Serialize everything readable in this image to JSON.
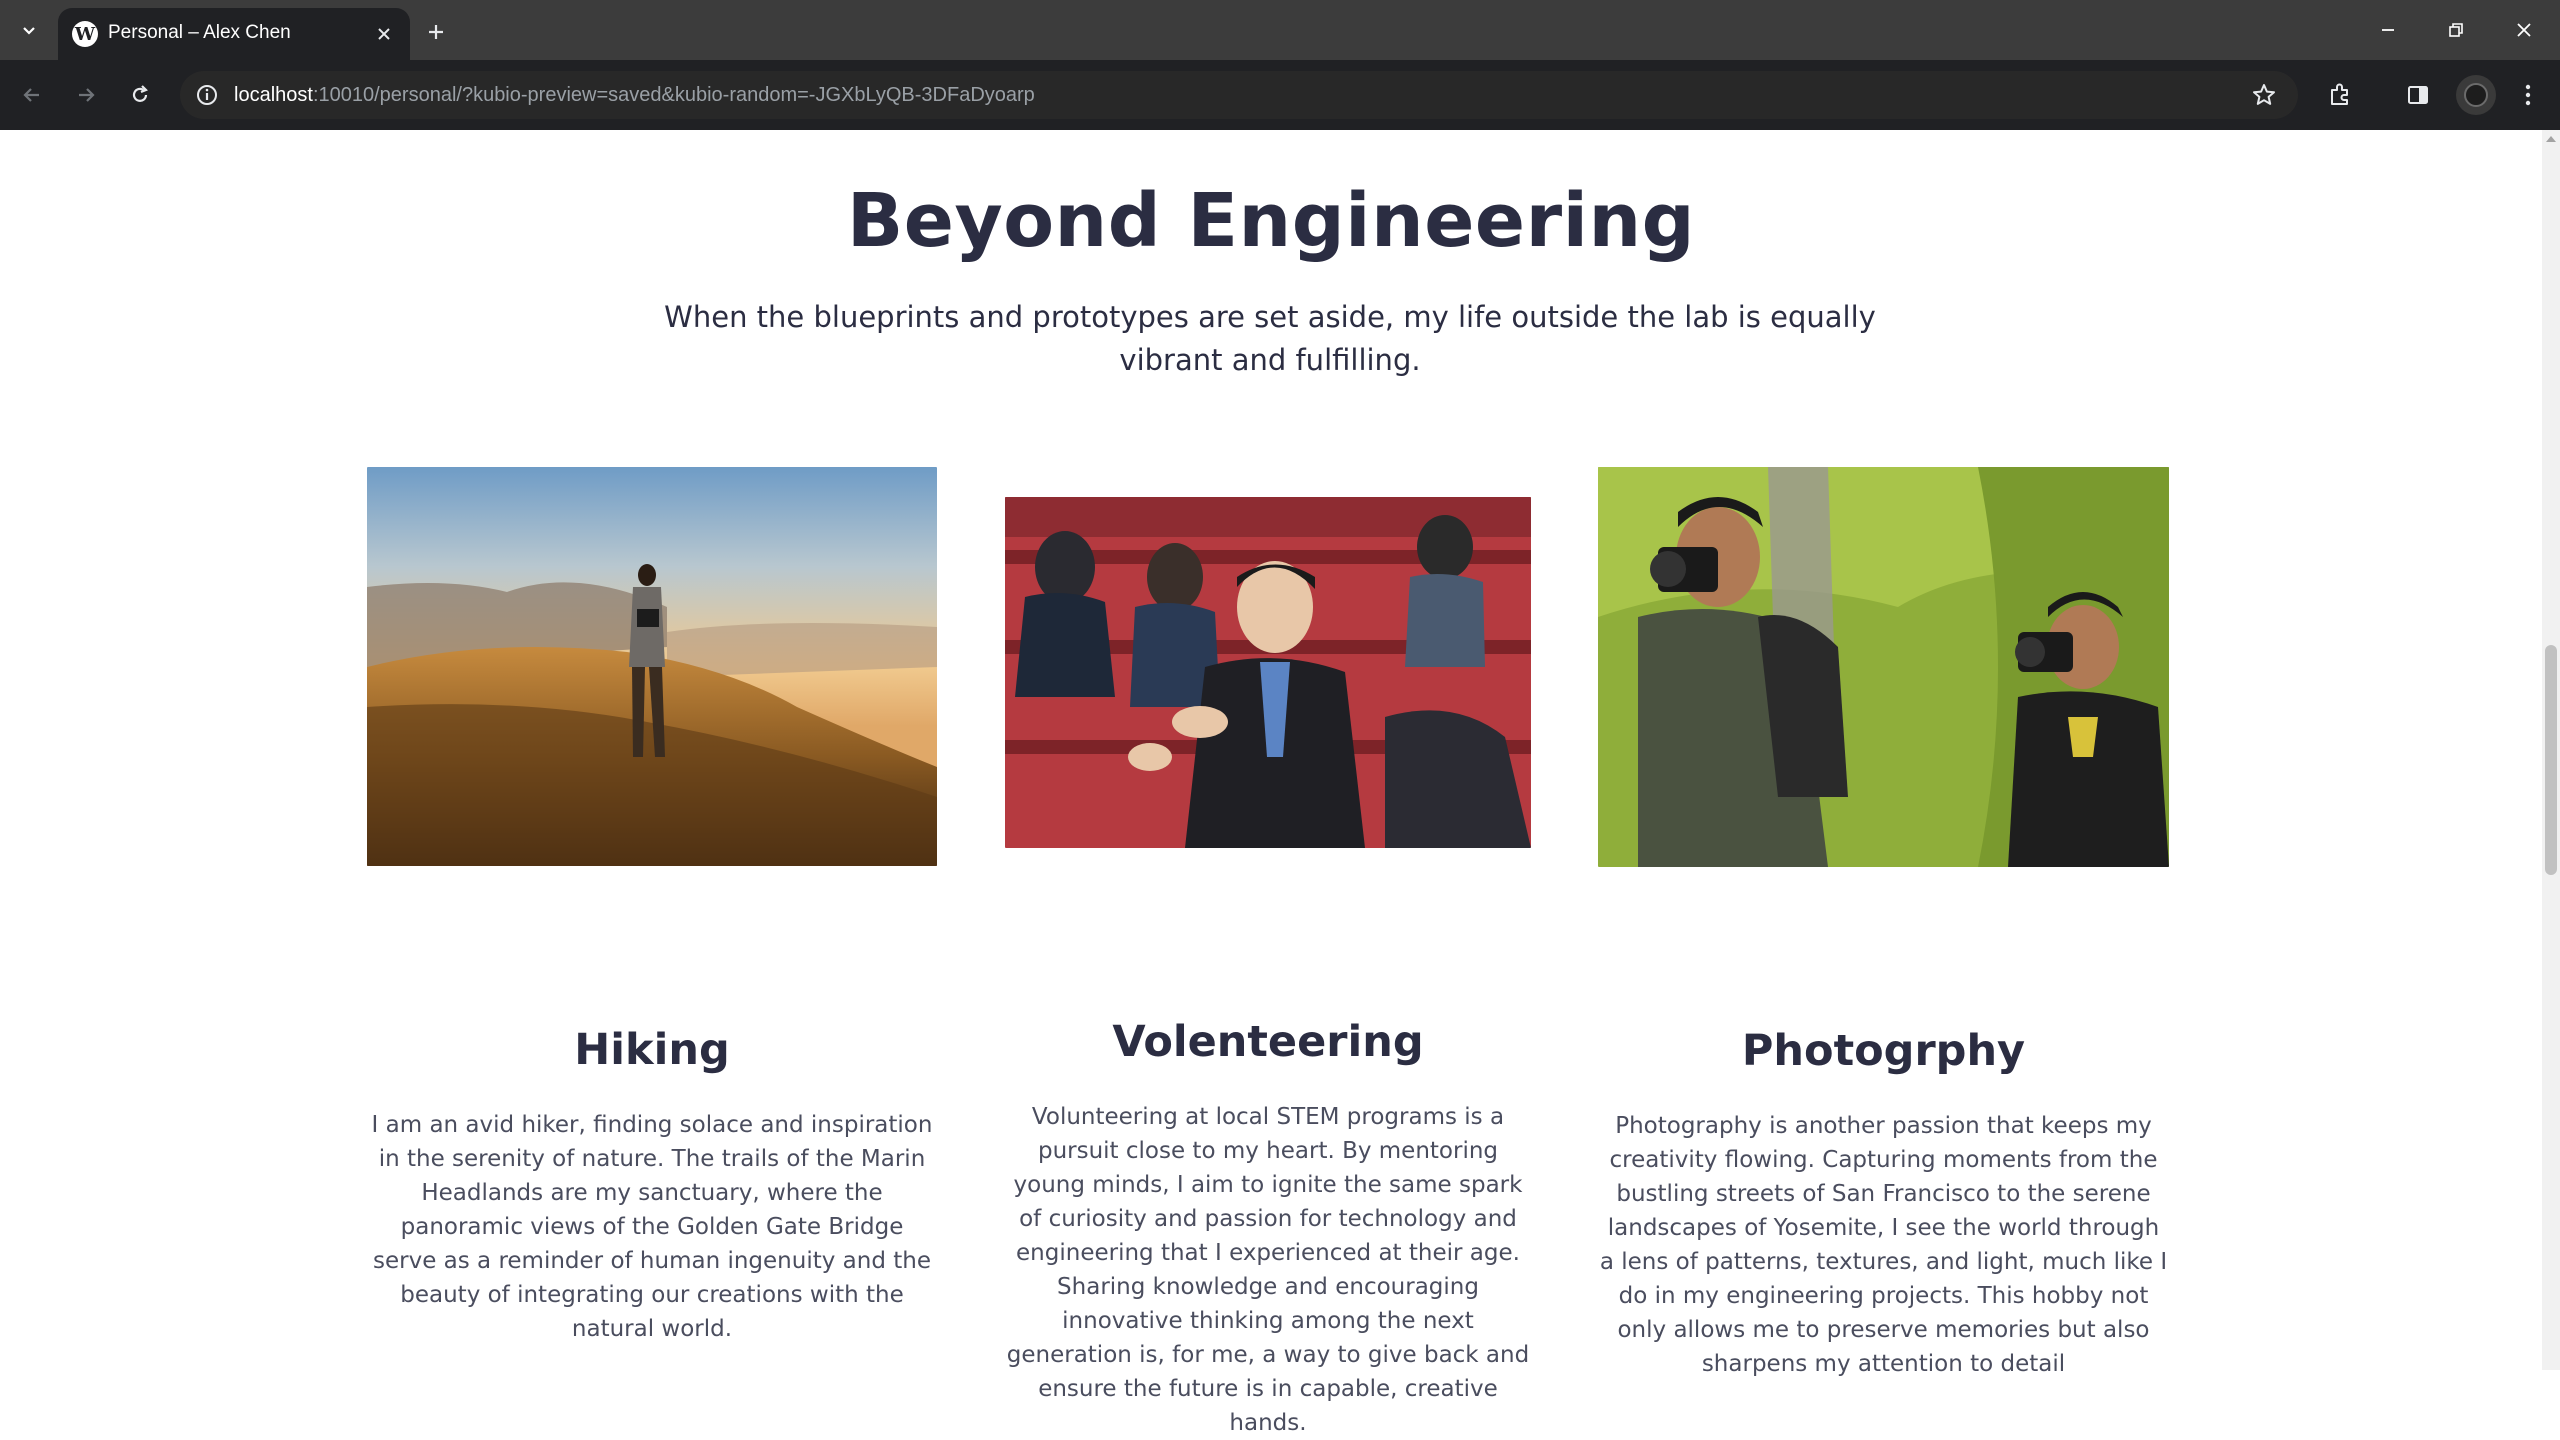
{
  "browser": {
    "tab_title": "Personal – Alex Chen",
    "url_host": "localhost",
    "url_path": ":10010/personal/?kubio-preview=saved&kubio-random=-JGXbLyQB-3DFaDyoarp"
  },
  "section": {
    "heading": "Beyond Engineering",
    "intro": "When the blueprints and prototypes are set aside, my life outside the lab is equally vibrant and fulfilling."
  },
  "cards": [
    {
      "title": "Hiking",
      "text": "I am an avid hiker, finding solace and inspiration in the serenity of nature. The trails of the Marin Headlands are my sanctuary, where the panoramic views of the Golden Gate Bridge serve as a reminder of human ingenuity and the beauty of integrating our creations with the natural world."
    },
    {
      "title": "Volenteering",
      "text": "Volunteering at local STEM programs is a pursuit close to my heart. By mentoring young minds, I aim to ignite the same spark of curiosity and passion for technology and engineering that I experienced at their age. Sharing knowledge and encouraging innovative thinking among the next generation is, for me, a way to give back and ensure the future is in capable, creative hands."
    },
    {
      "title": "Photogrphy",
      "text": "Photography is another passion that keeps my creativity flowing. Capturing moments from the bustling streets of San Francisco to the serene landscapes of Yosemite, I see the world through a lens of patterns, textures, and light, much like I do in my engineering projects. This hobby not only allows me to preserve memories but also sharpens my attention to detail"
    }
  ],
  "colors": {
    "heading": "#2b2d42",
    "body_text": "#4a4d5e",
    "chrome_dark": "#202124",
    "tabstrip": "#3c3c3c"
  },
  "icons": [
    "tab-search-icon",
    "wordpress-icon",
    "close-icon",
    "plus-icon",
    "minimize-icon",
    "restore-icon",
    "back-arrow-icon",
    "forward-arrow-icon",
    "reload-icon",
    "info-icon",
    "star-icon",
    "extensions-icon",
    "side-panel-icon",
    "profile-avatar",
    "kebab-menu-icon"
  ]
}
